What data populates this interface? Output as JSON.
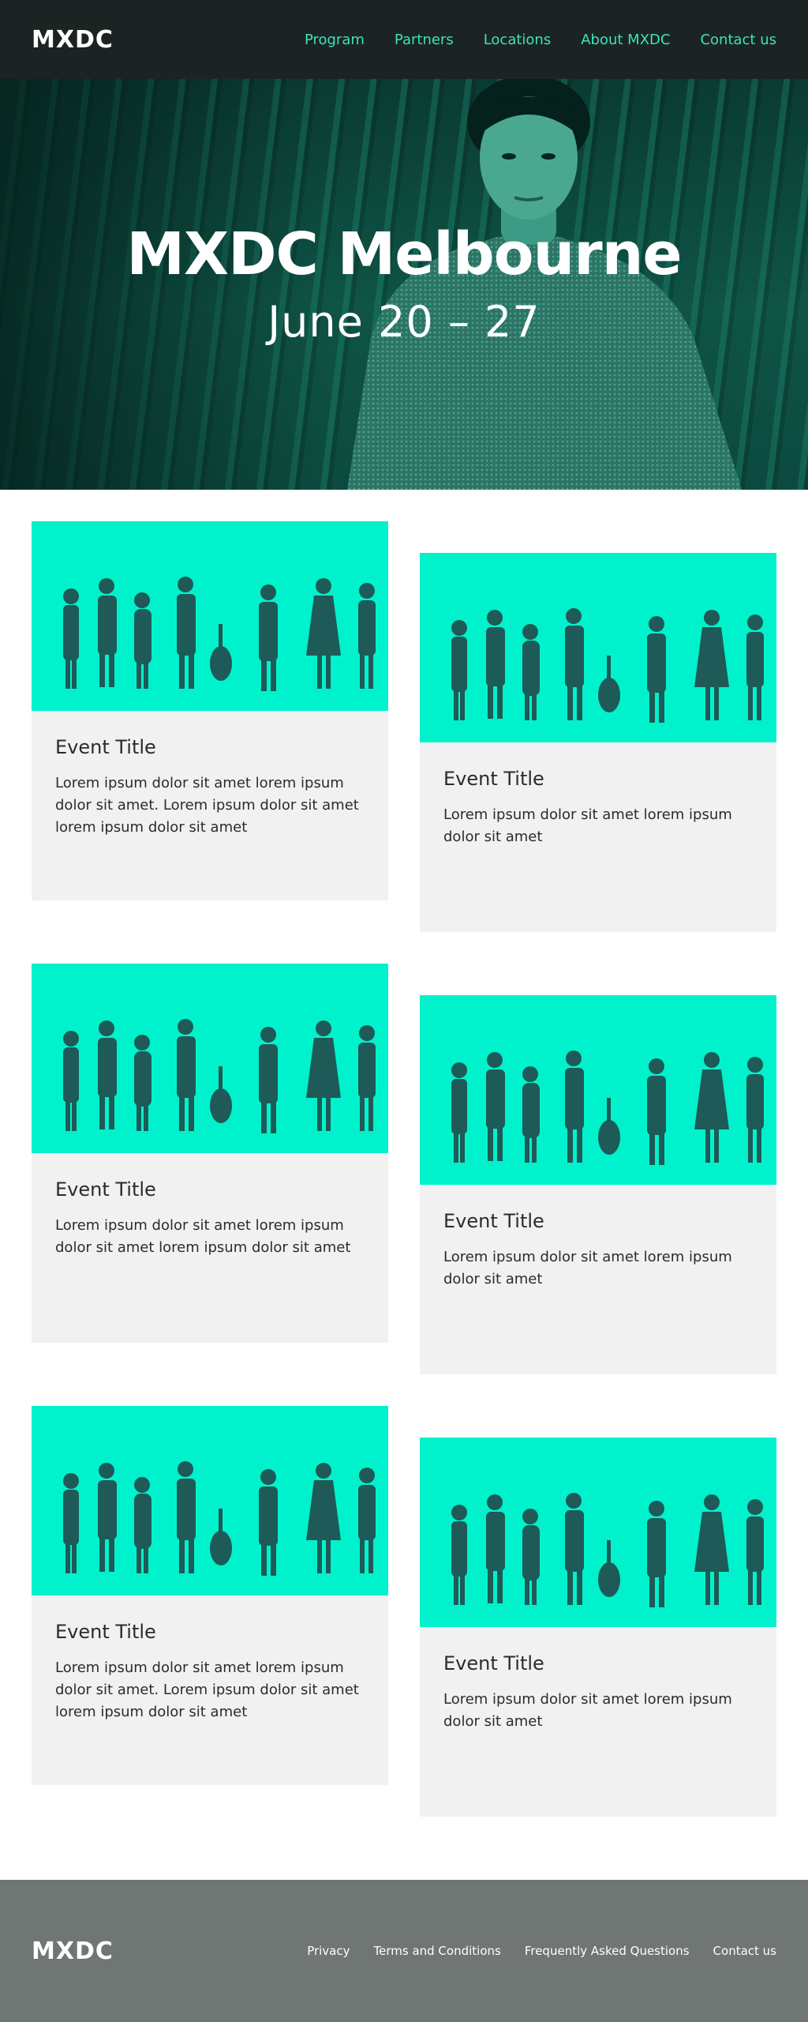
{
  "header": {
    "logo": "MXDC",
    "nav": [
      "Program",
      "Partners",
      "Locations",
      "About MXDC",
      "Contact us"
    ]
  },
  "hero": {
    "title": "MXDC Melbourne",
    "dates": "June 20 – 27"
  },
  "events": [
    {
      "title": "Event Title",
      "description": "Lorem ipsum dolor sit amet lorem ipsum dolor sit amet. Lorem ipsum dolor sit amet lorem ipsum dolor sit amet"
    },
    {
      "title": "Event Title",
      "description": "Lorem ipsum dolor sit amet lorem ipsum dolor sit amet"
    },
    {
      "title": "Event Title",
      "description": "Lorem ipsum dolor sit amet lorem ipsum dolor sit amet lorem ipsum dolor sit amet"
    },
    {
      "title": "Event Title",
      "description": "Lorem ipsum dolor sit amet lorem ipsum dolor sit amet"
    },
    {
      "title": "Event Title",
      "description": "Lorem ipsum dolor sit amet lorem ipsum dolor sit amet. Lorem ipsum dolor sit amet lorem ipsum dolor sit amet"
    },
    {
      "title": "Event Title",
      "description": "Lorem ipsum dolor sit amet lorem ipsum dolor sit amet"
    }
  ],
  "footer": {
    "logo": "MXDC",
    "links": [
      "Privacy",
      "Terms and Conditions",
      "Frequently Asked Questions",
      "Contact us"
    ]
  },
  "colors": {
    "header_bg": "#1c2423",
    "nav_accent": "#3ee0bd",
    "event_image_bg": "#00f2cd",
    "card_bg": "#f1f1f1",
    "footer_bg": "#6f7674"
  }
}
